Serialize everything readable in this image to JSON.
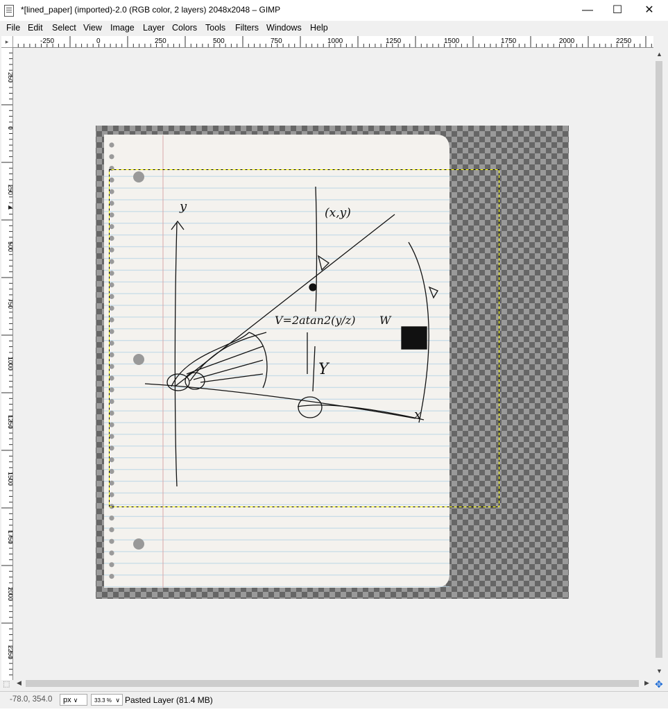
{
  "window": {
    "title": "*[lined_paper] (imported)-2.0 (RGB color, 2 layers) 2048x2048 – GIMP",
    "minimize_glyph": "—",
    "maximize_glyph": "☐",
    "close_glyph": "✕"
  },
  "menu": [
    {
      "label": "File"
    },
    {
      "label": "Edit"
    },
    {
      "label": "Select"
    },
    {
      "label": "View"
    },
    {
      "label": "Image"
    },
    {
      "label": "Layer"
    },
    {
      "label": "Colors"
    },
    {
      "label": "Tools"
    },
    {
      "label": "Filters"
    },
    {
      "label": "Windows"
    },
    {
      "label": "Help"
    }
  ],
  "rulers": {
    "horizontal_labels": [
      "-250",
      "0",
      "250",
      "500",
      "750",
      "1000",
      "1250",
      "1500",
      "1750",
      "2000",
      "2250"
    ],
    "vertical_labels": [
      "250",
      "0",
      "250",
      "500",
      "750",
      "1000",
      "1250",
      "1500",
      "1750",
      "2000",
      "2250"
    ]
  },
  "canvas": {
    "sketch_text": {
      "point_label": "(x,y)",
      "y_axis_label": "y",
      "z_label": "Y",
      "formula": "V=2atan2(y/z)",
      "w_label": "W",
      "x_axis_label": "x"
    }
  },
  "status": {
    "coordinates": "-78.0, 354.0",
    "unit": "px",
    "zoom": "33.3 %",
    "layer_info": "Pasted Layer (81.4 MB)"
  },
  "colors": {
    "checker_dark": "#666666",
    "checker_light": "#9a9a9a",
    "paper": "#f4f2ee",
    "line_blue": "#b9d6e6",
    "margin_red": "#d7a8a8",
    "selection": "#ffff00",
    "ink": "#111111"
  }
}
